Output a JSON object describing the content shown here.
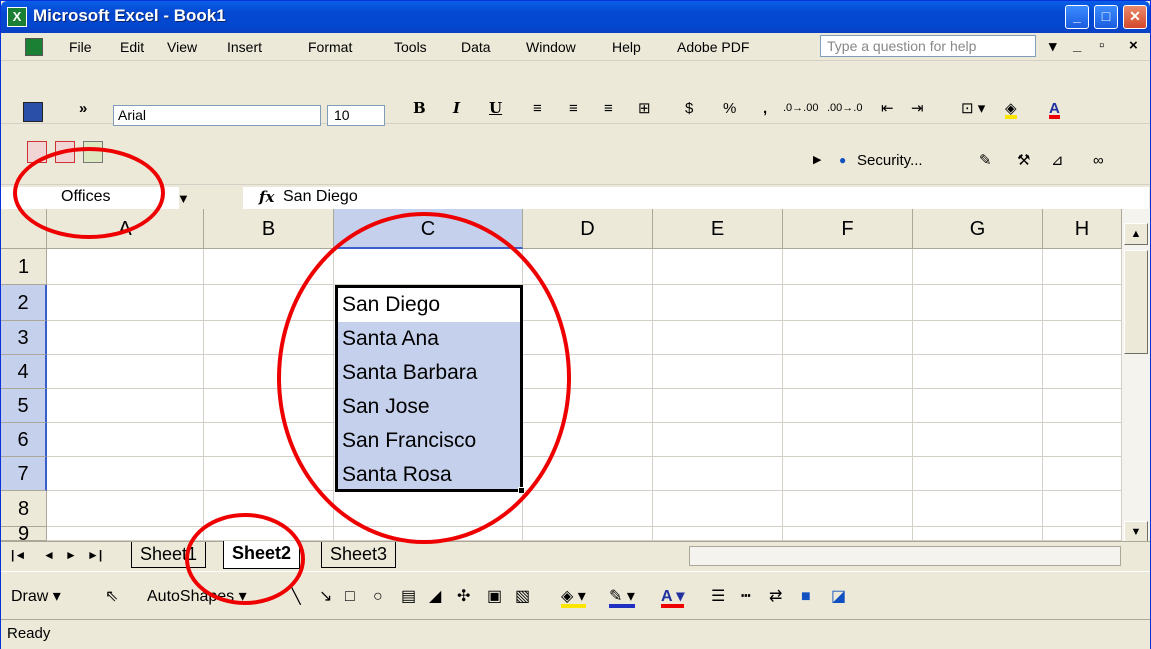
{
  "window": {
    "title": "Microsoft Excel - Book1",
    "app_icon": "X",
    "minimize": "_",
    "maximize": "□",
    "close": "✕"
  },
  "menu": {
    "items": [
      "File",
      "Edit",
      "View",
      "Insert",
      "Format",
      "Tools",
      "Data",
      "Window",
      "Help",
      "Adobe PDF"
    ],
    "help_placeholder": "Type a question for help",
    "controls": [
      "▾",
      "_",
      "▫",
      "×"
    ]
  },
  "formatting_toolbar": {
    "save_icon": "save-icon",
    "overflow": "»",
    "font": "Arial",
    "size": "10",
    "bold": "B",
    "italic": "I",
    "underline": "U",
    "currency": "$",
    "percent": "%",
    "comma": ",",
    "increase_decimal": ".0→.00",
    "decrease_decimal": ".00→.0"
  },
  "pdf_toolbar": {
    "security_label": "Security...",
    "play_icon": "▶",
    "dot": "●"
  },
  "formula_bar": {
    "name_box": "Offices",
    "fx": "fx",
    "value": "San Diego"
  },
  "grid": {
    "columns": [
      "A",
      "B",
      "C",
      "D",
      "E",
      "F",
      "G",
      "H"
    ],
    "rows": [
      "1",
      "2",
      "3",
      "4",
      "5",
      "6",
      "7",
      "8",
      "9"
    ],
    "selected_column": "C",
    "cells_C": [
      "San Diego",
      "Santa Ana",
      "Santa Barbara",
      "San Jose",
      "San Francisco",
      "Santa Rosa"
    ]
  },
  "sheet_tabs": {
    "nav": [
      "|◄",
      "◄",
      "►",
      "►|"
    ],
    "tabs": [
      "Sheet1",
      "Sheet2",
      "Sheet3"
    ],
    "active": "Sheet2"
  },
  "draw_toolbar": {
    "draw": "Draw ▾",
    "autoshapes": "AutoShapes ▾"
  },
  "status": {
    "text": "Ready"
  },
  "colors": {
    "annotation": "#e00000",
    "selection": "#c5d1ec",
    "title_bar": "#0447d0"
  }
}
